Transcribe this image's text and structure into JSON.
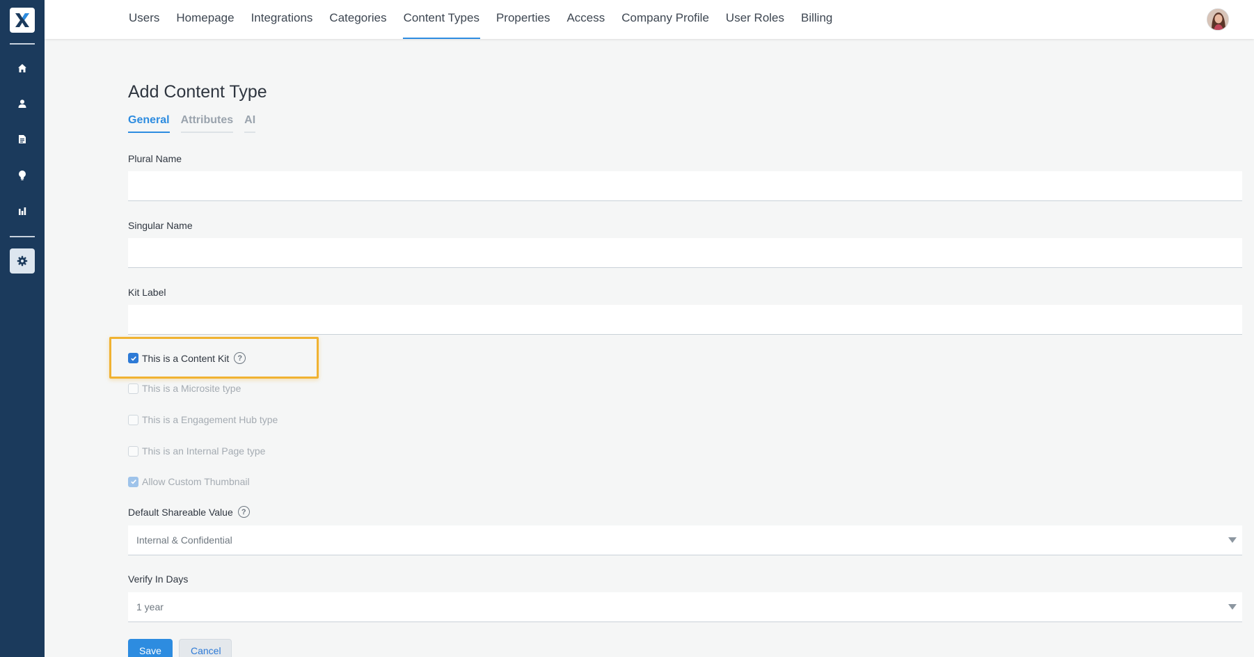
{
  "app": {
    "brand_letter": "X",
    "brand_color": "#1b3a5c",
    "accent": "#2d8ce0",
    "highlight_color": "#f0b232"
  },
  "sidebar": {
    "items": [
      {
        "icon": "home-icon"
      },
      {
        "icon": "user-icon"
      },
      {
        "icon": "document-icon"
      },
      {
        "icon": "lightbulb-icon"
      },
      {
        "icon": "chart-icon"
      },
      {
        "icon": "gear-icon",
        "active": true
      }
    ]
  },
  "nav": {
    "items": [
      {
        "label": "Users"
      },
      {
        "label": "Homepage"
      },
      {
        "label": "Integrations"
      },
      {
        "label": "Categories"
      },
      {
        "label": "Content Types",
        "active": true
      },
      {
        "label": "Properties"
      },
      {
        "label": "Access"
      },
      {
        "label": "Company Profile"
      },
      {
        "label": "User Roles"
      },
      {
        "label": "Billing"
      }
    ]
  },
  "page": {
    "title": "Add Content Type",
    "tabs": [
      {
        "label": "General",
        "active": true
      },
      {
        "label": "Attributes"
      },
      {
        "label": "AI"
      }
    ]
  },
  "form": {
    "plural_name": {
      "label": "Plural Name",
      "value": ""
    },
    "singular_name": {
      "label": "Singular Name",
      "value": ""
    },
    "kit_label": {
      "label": "Kit Label",
      "value": ""
    },
    "checkboxes": [
      {
        "label": "This is a Content Kit",
        "checked": true,
        "disabled": false,
        "help": true
      },
      {
        "label": "This is a Microsite type",
        "checked": false,
        "disabled": true
      },
      {
        "label": "This is a Engagement Hub type",
        "checked": false,
        "disabled": true
      },
      {
        "label": "This is an Internal Page type",
        "checked": false,
        "disabled": true
      },
      {
        "label": "Allow Custom Thumbnail",
        "checked": true,
        "disabled": true
      }
    ],
    "default_shareable": {
      "label": "Default Shareable Value",
      "value": "Internal & Confidential"
    },
    "verify_in_days": {
      "label": "Verify In Days",
      "value": "1 year"
    },
    "help_glyph": "?",
    "save_label": "Save",
    "cancel_label": "Cancel"
  }
}
